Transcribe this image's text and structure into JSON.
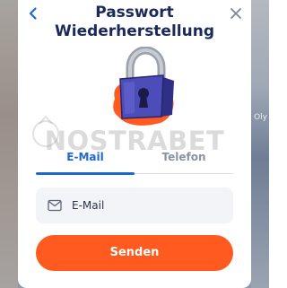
{
  "modal": {
    "title_line1": "Passwort",
    "title_line2": "Wiederherstellung"
  },
  "watermark": {
    "text": "NOSTRABET"
  },
  "background": {
    "right_partial_text": "Oly"
  },
  "tabs": [
    {
      "label": "E-Mail",
      "active": true
    },
    {
      "label": "Telefon",
      "active": false
    }
  ],
  "email_field": {
    "placeholder": "E-Mail",
    "value": ""
  },
  "submit_button": {
    "label": "Senden"
  },
  "icons": {
    "back": "chevron-left-icon",
    "close": "close-icon",
    "lock": "padlock-icon",
    "envelope": "envelope-icon"
  },
  "colors": {
    "accent_blue": "#1e68d3",
    "title_navy": "#1a2a5a",
    "button_orange": "#ff5a1f",
    "tab_inactive": "#8a93a3",
    "field_bg": "#f2f4f7",
    "lock_body": "#4c4db8",
    "lock_blob": "#ff5a1f"
  }
}
